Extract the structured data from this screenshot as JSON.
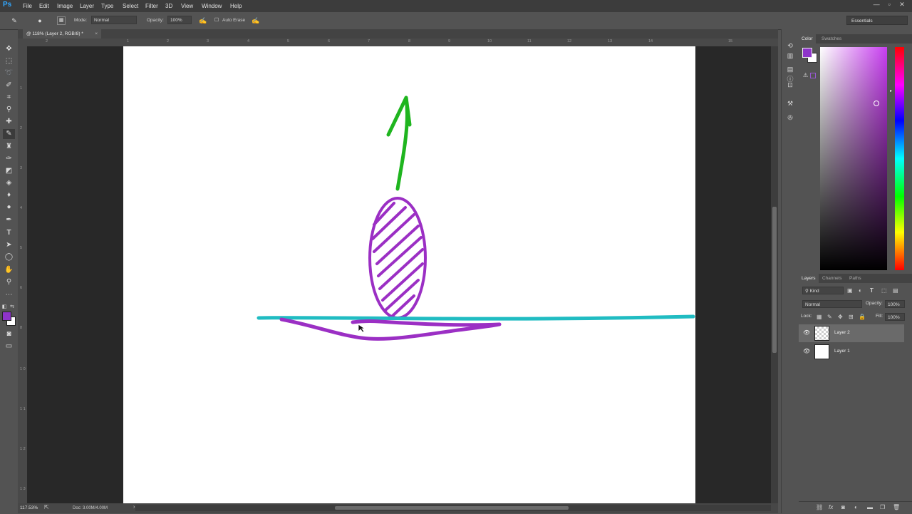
{
  "app": {
    "logo": "Ps"
  },
  "menu": [
    "File",
    "Edit",
    "Image",
    "Layer",
    "Type",
    "Select",
    "Filter",
    "3D",
    "View",
    "Window",
    "Help"
  ],
  "window_controls": [
    "—",
    "▫",
    "✕"
  ],
  "options": {
    "mode_label": "Mode:",
    "mode_value": "Normal",
    "opacity_label": "Opacity:",
    "opacity_value": "100%",
    "auto_erase_label": "Auto Erase",
    "workspace": "Essentials"
  },
  "document_tab": {
    "title": "@ 118% (Layer 2, RGB/8) *",
    "close": "×"
  },
  "ruler_top_ticks": [
    "2",
    "1",
    "2",
    "3",
    "4",
    "5",
    "6",
    "7",
    "8",
    "9",
    "10",
    "11",
    "12",
    "13",
    "14",
    "15"
  ],
  "ruler_left_ticks": [
    "1",
    "2",
    "3",
    "4",
    "5",
    "6",
    "7",
    "8",
    "9",
    "1 0",
    "1 1",
    "1 2",
    "1 3"
  ],
  "status": {
    "zoom": "117.53%",
    "doc_info": "Doc: 3.00M/4.00M"
  },
  "color_panel": {
    "tabs": [
      "Color",
      "Swatches"
    ],
    "foreground_color": "#8e34c9",
    "background_color": "#ffffff"
  },
  "layers_panel": {
    "tabs": [
      "Layers",
      "Channels",
      "Paths"
    ],
    "filter_kind": "Kind",
    "blend_mode": "Normal",
    "opacity_label": "Opacity:",
    "opacity_value": "100%",
    "lock_label": "Lock:",
    "fill_label": "Fill:",
    "fill_value": "100%",
    "layers": [
      {
        "name": "Layer 2",
        "selected": true
      },
      {
        "name": "Layer 1",
        "selected": false
      }
    ]
  },
  "canvas_drawing": {
    "stroke_colors": {
      "arrow": "#1fb51f",
      "object": "#9b2fc4",
      "surface": "#20bcc2"
    }
  }
}
